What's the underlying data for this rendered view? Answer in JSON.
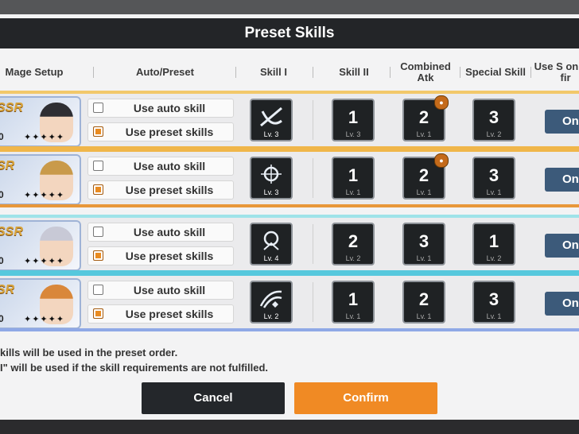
{
  "title": "Preset Skills",
  "headers": {
    "mage_setup": "Mage Setup",
    "auto_preset": "Auto/Preset",
    "skill_1": "Skill I",
    "skill_2": "Skill II",
    "combined_atk": "Combined Atk",
    "special_skill": "Special Skill",
    "use_first": "Use S on the fir"
  },
  "rows": [
    {
      "rarity": "SSR",
      "level": "0",
      "stars": "✦✦✦✦✦",
      "auto_label": "Use auto skill",
      "preset_label": "Use preset skills",
      "preset_checked": true,
      "skill1_lv": "Lv. 3",
      "skill2": {
        "order": "1",
        "lv": "Lv. 3"
      },
      "combined": {
        "order": "2",
        "lv": "Lv. 1"
      },
      "special": {
        "order": "3",
        "lv": "Lv. 2"
      },
      "on_label": "On",
      "band_top": "#f2c86a",
      "band_bottom": "#f0b64a"
    },
    {
      "rarity": "SR",
      "level": "0",
      "stars": "✦✦✦✦✦",
      "auto_label": "Use auto skill",
      "preset_label": "Use preset skills",
      "preset_checked": true,
      "skill1_lv": "Lv. 3",
      "skill2": {
        "order": "1",
        "lv": "Lv. 1"
      },
      "combined": {
        "order": "2",
        "lv": "Lv. 1"
      },
      "special": {
        "order": "3",
        "lv": "Lv. 1"
      },
      "on_label": "On",
      "band_top": "#f0b64a",
      "band_bottom": "#e8973a"
    },
    {
      "rarity": "SSR",
      "level": "0",
      "stars": "✦✦✦✦✦",
      "auto_label": "Use auto skill",
      "preset_label": "Use preset skills",
      "preset_checked": true,
      "skill1_lv": "Lv. 4",
      "skill2": {
        "order": "2",
        "lv": "Lv. 2"
      },
      "combined": {
        "order": "3",
        "lv": "Lv. 1"
      },
      "special": {
        "order": "1",
        "lv": "Lv. 2"
      },
      "on_label": "On",
      "band_top": "#9fe3e9",
      "band_bottom": "#56c8dd"
    },
    {
      "rarity": "SR",
      "level": "0",
      "stars": "✦✦✦✦✦",
      "auto_label": "Use auto skill",
      "preset_label": "Use preset skills",
      "preset_checked": true,
      "skill1_lv": "Lv. 2",
      "skill2": {
        "order": "1",
        "lv": "Lv. 1"
      },
      "combined": {
        "order": "2",
        "lv": "Lv. 1"
      },
      "special": {
        "order": "3",
        "lv": "Lv. 1"
      },
      "on_label": "On",
      "band_top": "#56c8dd",
      "band_bottom": "#8fa8e6"
    }
  ],
  "notes": [
    "kills will be used in the preset order.",
    "I\" will be used if the skill requirements are not fulfilled."
  ],
  "buttons": {
    "cancel": "Cancel",
    "confirm": "Confirm"
  },
  "colors": {
    "confirm": "#f08a24",
    "cancel": "#24272b",
    "on_button": "#3c5a7a",
    "checkbox": "#e98b21"
  }
}
